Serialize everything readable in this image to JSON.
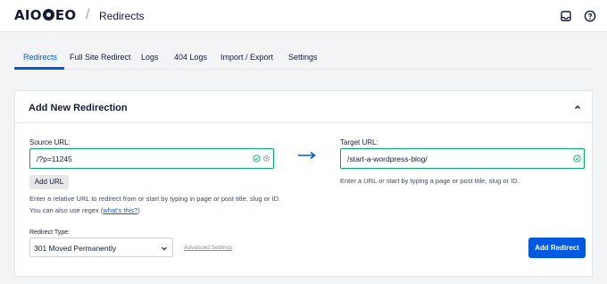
{
  "app": {
    "logo_prefix": "AIO",
    "logo_suffix": "EO",
    "separator": "/",
    "page_title": "Redirects"
  },
  "header_icons": [
    "inbox-icon",
    "help-icon"
  ],
  "tabs": [
    {
      "label": "Redirects",
      "active": true
    },
    {
      "label": "Full Site Redirect",
      "active": false
    },
    {
      "label": "Logs",
      "active": false
    },
    {
      "label": "404 Logs",
      "active": false
    },
    {
      "label": "Import / Export",
      "active": false
    },
    {
      "label": "Settings",
      "active": false
    }
  ],
  "panel": {
    "title": "Add New Redirection",
    "source": {
      "label": "Source URL:",
      "value": "/?p=11245",
      "add_url_label": "Add URL",
      "help_text": "Enter a relative URL to redirect from or start by typing in page or post title, slug or ID. You can also use regex (",
      "help_link": "what's this?",
      "help_text_end": ")"
    },
    "target": {
      "label": "Target URL:",
      "value": "/start-a-wordpress-blog/",
      "help_text": "Enter a URL or start by typing a page or post title, slug or ID."
    },
    "redirect_type": {
      "label": "Redirect Type:",
      "selected": "301 Moved Permanently"
    },
    "advanced_settings_label": "Advanced Settings",
    "add_redirect_label": "Add Redirect"
  },
  "colors": {
    "accent": "#005ae0",
    "valid": "#00aa63",
    "text": "#141b38"
  }
}
